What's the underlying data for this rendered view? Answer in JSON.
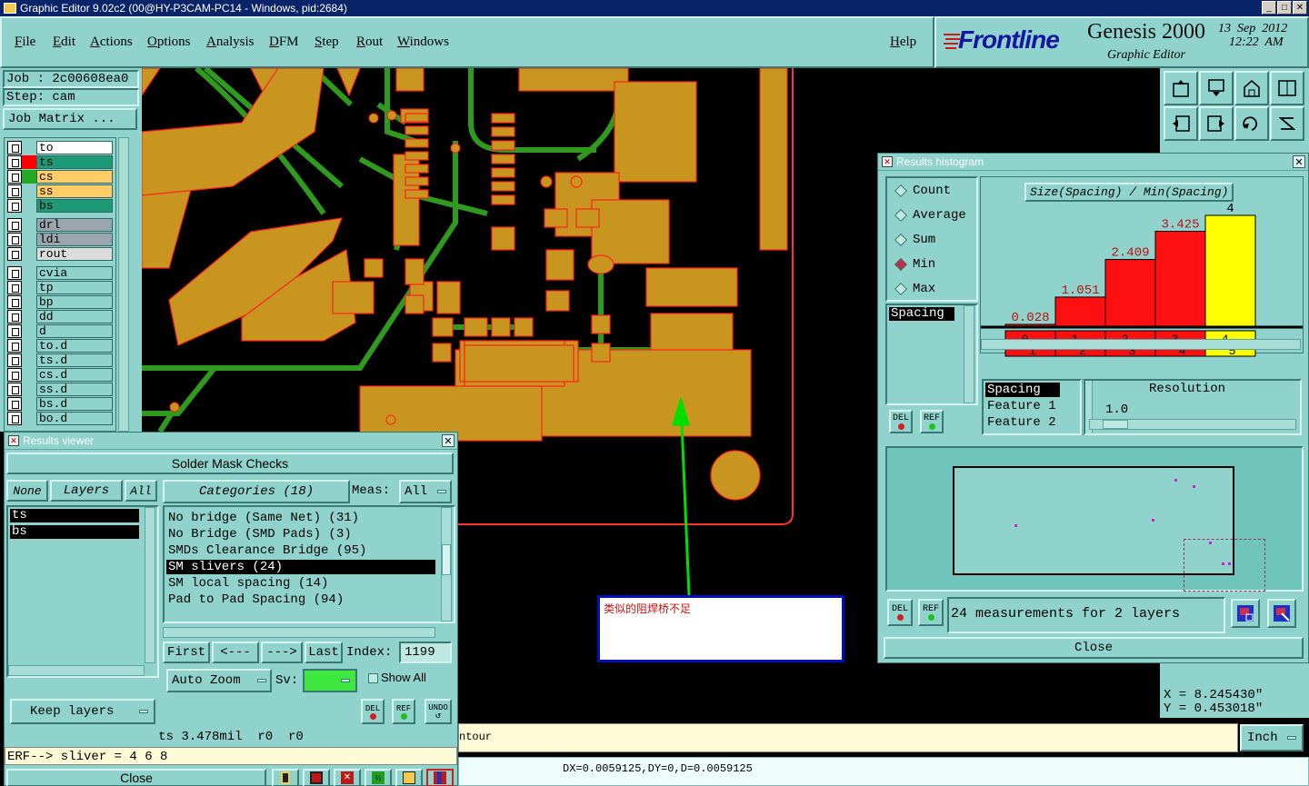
{
  "window": {
    "title": "Graphic Editor 9.02c2 (00@HY-P3CAM-PC14 - Windows, pid:2684)"
  },
  "menu": {
    "items": [
      "File",
      "Edit",
      "Actions",
      "Options",
      "Analysis",
      "DFM",
      "Step",
      "Rout",
      "Windows"
    ],
    "help": "Help"
  },
  "brand": {
    "logo": "Frontline",
    "product": "Genesis 2000",
    "subtitle": "Graphic Editor",
    "date": "13  Sep  2012",
    "time": "12:22  AM"
  },
  "job": {
    "job_label": "Job : 2c00608ea0",
    "step_label": "Step: cam",
    "matrix_button": "Job Matrix ..."
  },
  "layers": [
    {
      "name": "to",
      "color": "#ffffff",
      "swatch": "#8fd3cc"
    },
    {
      "name": "ts",
      "color": "#1e9a76",
      "swatch": "#ff0000",
      "active": true
    },
    {
      "name": "cs",
      "color": "#ffcc66",
      "swatch": "#22aa22"
    },
    {
      "name": "ss",
      "color": "#ffcc66",
      "swatch": "#8fd3cc"
    },
    {
      "name": "bs",
      "color": "#1e9a76",
      "swatch": "#8fd3cc"
    },
    {
      "name": "drl",
      "color": "#9aa6ae",
      "swatch": "#8fd3cc"
    },
    {
      "name": "ldi",
      "color": "#9aa6ae",
      "swatch": "#8fd3cc"
    },
    {
      "name": "rout",
      "color": "#dcdcdc",
      "swatch": "#8fd3cc"
    },
    {
      "name": "cvia",
      "color": "#8fd3cc",
      "swatch": "#8fd3cc"
    },
    {
      "name": "tp",
      "color": "#8fd3cc",
      "swatch": "#8fd3cc"
    },
    {
      "name": "bp",
      "color": "#8fd3cc",
      "swatch": "#8fd3cc"
    },
    {
      "name": "dd",
      "color": "#8fd3cc",
      "swatch": "#8fd3cc"
    },
    {
      "name": "d",
      "color": "#8fd3cc",
      "swatch": "#8fd3cc"
    },
    {
      "name": "to.d",
      "color": "#8fd3cc",
      "swatch": "#8fd3cc"
    },
    {
      "name": "ts.d",
      "color": "#8fd3cc",
      "swatch": "#8fd3cc"
    },
    {
      "name": "cs.d",
      "color": "#8fd3cc",
      "swatch": "#8fd3cc"
    },
    {
      "name": "ss.d",
      "color": "#8fd3cc",
      "swatch": "#8fd3cc"
    },
    {
      "name": "bs.d",
      "color": "#8fd3cc",
      "swatch": "#8fd3cc"
    },
    {
      "name": "bo.d",
      "color": "#8fd3cc",
      "swatch": "#8fd3cc"
    }
  ],
  "annotation": {
    "text": "类似的阻焊桥不足"
  },
  "histogram": {
    "title": "Results histogram",
    "modes": [
      {
        "label": "Count",
        "selected": false
      },
      {
        "label": "Average",
        "selected": false
      },
      {
        "label": "Sum",
        "selected": false
      },
      {
        "label": "Min",
        "selected": true
      },
      {
        "label": "Max",
        "selected": false
      }
    ],
    "list_item": "Spacing",
    "formula": "Size(Spacing) / Min(Spacing)",
    "bins": [
      {
        "range": "0-1",
        "value": 0.028,
        "value_label": "0.028",
        "color": "#ff1010"
      },
      {
        "range": "1-2",
        "value": 1.051,
        "value_label": "1.051",
        "color": "#ff1010"
      },
      {
        "range": "2-3",
        "value": 2.409,
        "value_label": "2.409",
        "color": "#ff1010"
      },
      {
        "range": "3-4",
        "value": 3.425,
        "value_label": "3.425",
        "color": "#ff1010"
      },
      {
        "range": "4-5",
        "value": 4,
        "value_label": "4",
        "color": "#ffff00"
      }
    ],
    "bin_labels": [
      [
        "0-",
        "1"
      ],
      [
        "1-",
        "2"
      ],
      [
        "2-",
        "3"
      ],
      [
        "3-",
        "4"
      ],
      [
        "4-",
        "5"
      ]
    ],
    "value_max": 4,
    "attributes": [
      "Spacing",
      "Feature 1",
      "Feature 2"
    ],
    "resolution_label": "Resolution",
    "resolution_value": "1.0",
    "del": "DEL",
    "ref": "REF",
    "measurements": "24 measurements for 2 layers",
    "close": "Close"
  },
  "viewer": {
    "title": "Results viewer",
    "heading": "Solder Mask Checks",
    "none": "None",
    "layers_btn": "Layers",
    "all_btn": "All",
    "layer_list": [
      "ts",
      "bs"
    ],
    "categories_btn": "Categories (18)",
    "meas_label": "Meas:",
    "meas_value": "All",
    "categories": [
      {
        "text": "No bridge (Same Net) (31)",
        "selected": false
      },
      {
        "text": "No Bridge (SMD Pads) (3)",
        "selected": false
      },
      {
        "text": "SMDs Clearance Bridge (95)",
        "selected": false
      },
      {
        "text": "SM slivers (24)",
        "selected": true
      },
      {
        "text": "SM local spacing (14)",
        "selected": false
      },
      {
        "text": "Pad to Pad Spacing (94)",
        "selected": false
      }
    ],
    "first": "First",
    "prev": "<---",
    "next": "--->",
    "last": "Last",
    "index_label": "Index:",
    "index_value": "1199",
    "auto_zoom": "Auto Zoom",
    "sv_label": "Sv:",
    "show_all": "Show All",
    "keep_layers": "Keep layers",
    "del": "DEL",
    "ref": "REF",
    "undo": "UNDO",
    "status": "ts 3.478mil  r0  r0",
    "erf": "ERF--> sliver = 4 6 8",
    "close": "Close"
  },
  "coords": {
    "x": "X = 8.245430\"",
    "y": "Y = 0.453018\""
  },
  "statusbar": {
    "mode_text": "ntour",
    "unit": "Inch",
    "measure": "DX=0.0059125,DY=0,D=0.0059125"
  },
  "colors": {
    "panel": "#8fd3cc",
    "copper": "#c8961e",
    "trace": "#2f9a1e",
    "outline": "#ff2020",
    "board_edge": "#ff3030"
  }
}
